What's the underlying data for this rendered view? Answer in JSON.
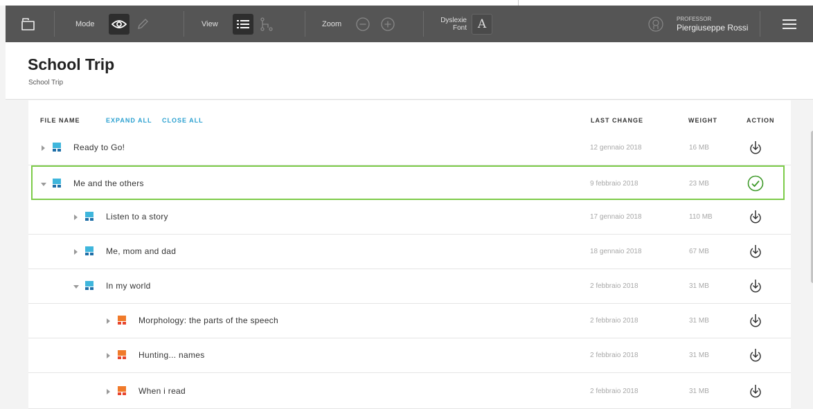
{
  "toolbar": {
    "mode_label": "Mode",
    "view_label": "View",
    "zoom_label": "Zoom",
    "dyslexie_label_1": "Dyslexie",
    "dyslexie_label_2": "Font",
    "dyslexie_glyph": "A",
    "user_role": "PROFESSOR",
    "user_name": "Piergiuseppe Rossi"
  },
  "header": {
    "title": "School Trip",
    "breadcrumb": "School Trip"
  },
  "table": {
    "col_file": "FILE NAME",
    "expand_all": "EXPAND ALL",
    "close_all": "CLOSE ALL",
    "col_last_change": "LAST CHANGE",
    "col_weight": "WEIGHT",
    "col_action": "ACTION",
    "rows": [
      {
        "name": "Ready to Go!",
        "date": "12 gennaio 2018",
        "weight": "16 MB",
        "expanded": false,
        "color": "blue",
        "level": 0,
        "status": "download"
      },
      {
        "name": "Me and the others",
        "date": "9 febbraio 2018",
        "weight": "23 MB",
        "expanded": true,
        "color": "blue",
        "level": 0,
        "status": "downloaded"
      },
      {
        "name": "Listen to a story",
        "date": "17 gennaio 2018",
        "weight": "110 MB",
        "expanded": false,
        "color": "blue",
        "level": 1,
        "status": "download"
      },
      {
        "name": "Me, mom and dad",
        "date": "18 gennaio 2018",
        "weight": "67 MB",
        "expanded": false,
        "color": "blue",
        "level": 1,
        "status": "download"
      },
      {
        "name": "In my world",
        "date": "2 febbraio 2018",
        "weight": "31 MB",
        "expanded": true,
        "color": "blue",
        "level": 1,
        "status": "download"
      },
      {
        "name": "Morphology: the parts of the speech",
        "date": "2 febbraio 2018",
        "weight": "31 MB",
        "expanded": false,
        "color": "orange",
        "level": 2,
        "status": "download"
      },
      {
        "name": "Hunting... names",
        "date": "2 febbraio 2018",
        "weight": "31 MB",
        "expanded": false,
        "color": "orange",
        "level": 2,
        "status": "download"
      },
      {
        "name": "When i read",
        "date": "2 febbraio 2018",
        "weight": "31 MB",
        "expanded": false,
        "color": "orange",
        "level": 2,
        "status": "download"
      }
    ]
  },
  "colors": {
    "toolbar_bg": "#555555",
    "accent_link": "#2aa0d0",
    "selected_border": "#7ccb48",
    "file_blue": "#3fb6dc",
    "file_blue_dark": "#1f6fa8",
    "file_orange": "#f07a2a",
    "file_red": "#e8462e"
  }
}
